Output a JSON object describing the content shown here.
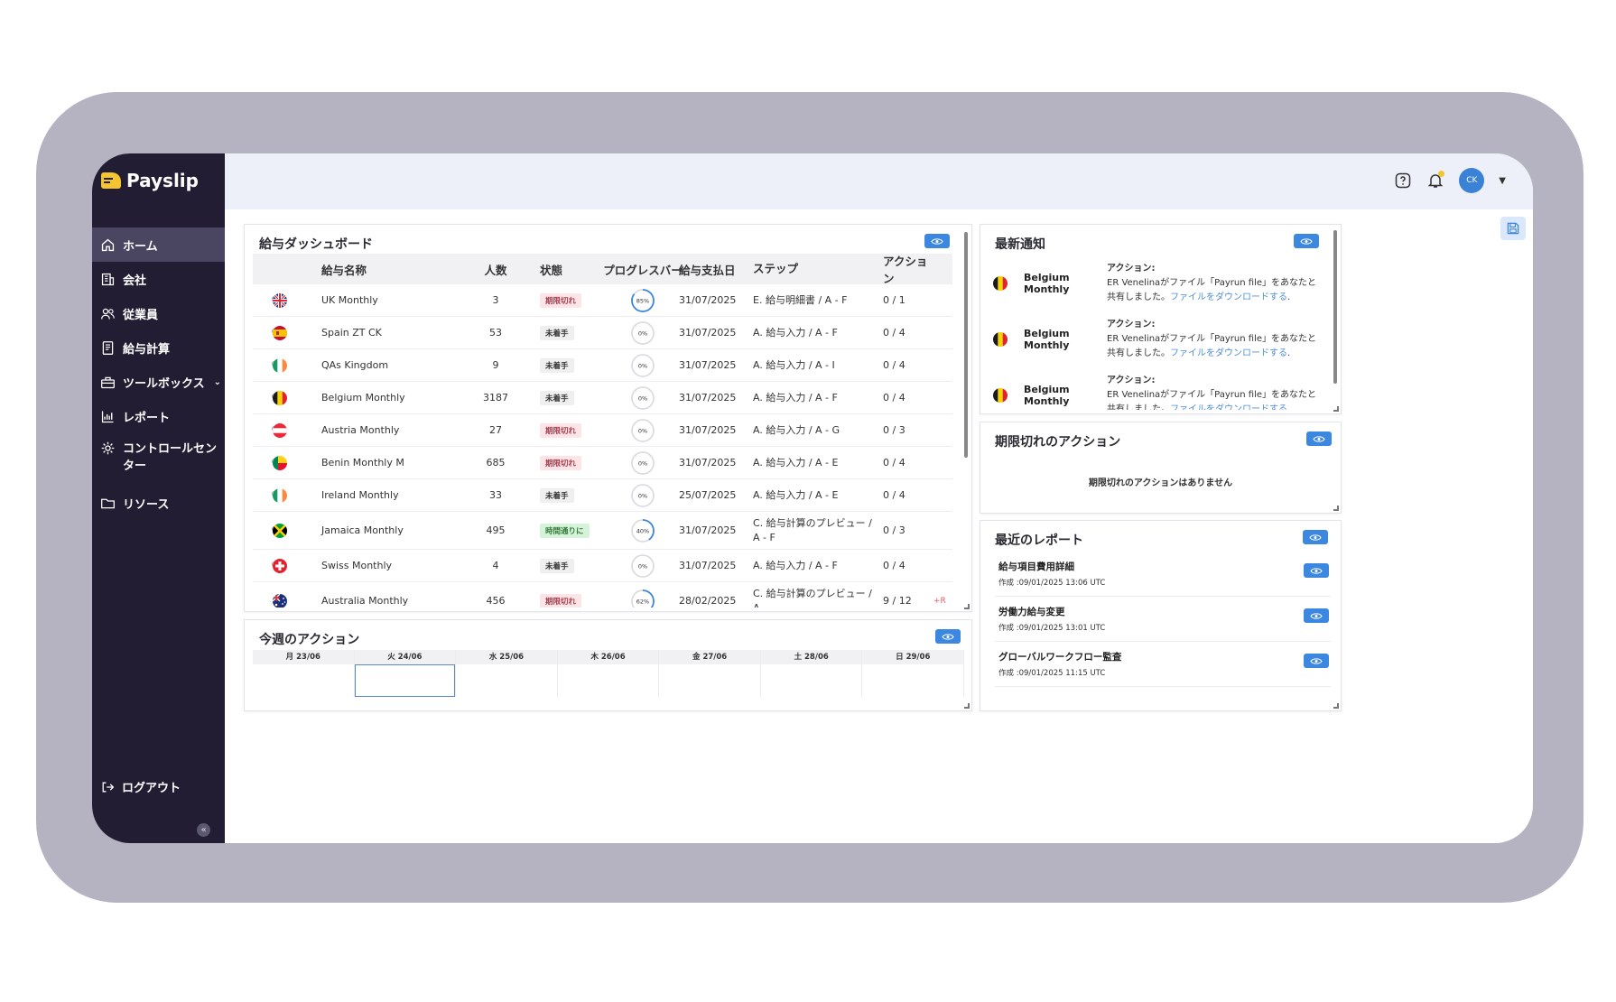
{
  "brand": {
    "name": "Payslip",
    "logo_color": "#f4c531"
  },
  "sidebar": {
    "items": [
      {
        "label": "ホーム",
        "icon": "home-icon",
        "active": true
      },
      {
        "label": "会社",
        "icon": "building-icon"
      },
      {
        "label": "従業員",
        "icon": "users-icon"
      },
      {
        "label": "給与計算",
        "icon": "payroll-icon"
      },
      {
        "label": "ツールボックス",
        "icon": "toolbox-icon"
      },
      {
        "label": "レポート",
        "icon": "chart-icon"
      },
      {
        "label": "コントロールセンター",
        "icon": "gear-icon"
      },
      {
        "label": "リソース",
        "icon": "folder-icon"
      }
    ],
    "logout": "ログアウト",
    "collapse": "«"
  },
  "header": {
    "avatar": "CK",
    "help_icon": "help-icon",
    "bell_icon": "bell-icon"
  },
  "dashboard": {
    "title": "給与ダッシュボード",
    "columns": [
      "給与名称",
      "人数",
      "状態",
      "プログレスバー",
      "給与支払日",
      "ステップ",
      "アクション"
    ],
    "rows": [
      {
        "flag": "uk",
        "name": "UK Monthly",
        "count": "3",
        "status": "期限切れ",
        "status_type": "overdue",
        "progress": 85,
        "progress_label": "85%",
        "date": "31/07/2025",
        "step": "E. 給与明細書 / A - F",
        "action": "0 / 1"
      },
      {
        "flag": "es",
        "name": "Spain ZT CK",
        "count": "53",
        "status": "未着手",
        "status_type": "notstarted",
        "progress": 0,
        "progress_label": "0%",
        "date": "31/07/2025",
        "step": "A. 給与入力 / A - F",
        "action": "0 / 4"
      },
      {
        "flag": "ie",
        "name": "QAs Kingdom",
        "count": "9",
        "status": "未着手",
        "status_type": "notstarted",
        "progress": 0,
        "progress_label": "0%",
        "date": "31/07/2025",
        "step": "A. 給与入力 / A - I",
        "action": "0 / 4"
      },
      {
        "flag": "be",
        "name": "Belgium Monthly",
        "count": "3187",
        "status": "未着手",
        "status_type": "notstarted",
        "progress": 0,
        "progress_label": "0%",
        "date": "31/07/2025",
        "step": "A. 給与入力 / A - F",
        "action": "0 / 4"
      },
      {
        "flag": "at",
        "name": "Austria Monthly",
        "count": "27",
        "status": "期限切れ",
        "status_type": "overdue",
        "progress": 0,
        "progress_label": "0%",
        "date": "31/07/2025",
        "step": "A. 給与入力 / A - G",
        "action": "0 / 3"
      },
      {
        "flag": "bj",
        "name": "Benin Monthly M",
        "count": "685",
        "status": "期限切れ",
        "status_type": "overdue",
        "progress": 0,
        "progress_label": "0%",
        "date": "31/07/2025",
        "step": "A. 給与入力 / A - E",
        "action": "0 / 4"
      },
      {
        "flag": "ie",
        "name": "Ireland Monthly",
        "count": "33",
        "status": "未着手",
        "status_type": "notstarted",
        "progress": 0,
        "progress_label": "0%",
        "date": "25/07/2025",
        "step": "A. 給与入力 / A - E",
        "action": "0 / 4"
      },
      {
        "flag": "jm",
        "name": "Jamaica Monthly",
        "count": "495",
        "status": "時間通りに",
        "status_type": "ontime",
        "progress": 40,
        "progress_label": "40%",
        "date": "31/07/2025",
        "step": "C. 給与計算のプレビュー / A - F",
        "action": "0 / 3",
        "tall": true
      },
      {
        "flag": "ch",
        "name": "Swiss Monthly",
        "count": "4",
        "status": "未着手",
        "status_type": "notstarted",
        "progress": 0,
        "progress_label": "0%",
        "date": "31/07/2025",
        "step": "A. 給与入力 / A - F",
        "action": "0 / 4"
      },
      {
        "flag": "au",
        "name": "Australia Monthly",
        "count": "456",
        "status": "期限切れ",
        "status_type": "overdue",
        "progress": 62,
        "progress_label": "62%",
        "date": "28/02/2025",
        "step": "C. 給与計算のプレビュー / A -",
        "action": "9 / 12",
        "extra": "+R",
        "tall": true
      }
    ]
  },
  "week": {
    "title": "今週のアクション",
    "days": [
      "月 23/06",
      "火 24/06",
      "水 25/06",
      "木 26/06",
      "金 27/06",
      "土 28/06",
      "日 29/06"
    ],
    "selected": 1
  },
  "notifications": {
    "title": "最新通知",
    "items": [
      {
        "flag": "be",
        "name": "Belgium Monthly",
        "label": "アクション:",
        "text": "ER Venelinaがファイル「Payrun file」をあなたと共有しました。",
        "link": "ファイルをダウンロードする",
        "tail": "."
      },
      {
        "flag": "be",
        "name": "Belgium Monthly",
        "label": "アクション:",
        "text": "ER Venelinaがファイル「Payrun file」をあなたと共有しました。",
        "link": "ファイルをダウンロードする",
        "tail": "."
      },
      {
        "flag": "be",
        "name": "Belgium Monthly",
        "label": "アクション:",
        "text": "ER Venelinaがファイル「Payrun file」をあなたと共有しました。",
        "link": "ファイルをダウンロードする",
        "tail": "."
      }
    ]
  },
  "overdue": {
    "title": "期限切れのアクション",
    "empty": "期限切れのアクションはありません"
  },
  "reports": {
    "title": "最近のレポート",
    "items": [
      {
        "name": "給与項目費用詳細",
        "date": "作成 :09/01/2025 13:06 UTC"
      },
      {
        "name": "労働力給与変更",
        "date": "作成 :09/01/2025 13:01 UTC"
      },
      {
        "name": "グローバルワークフロー監査",
        "date": "作成 :09/01/2025 11:15 UTC"
      }
    ]
  },
  "colors": {
    "accent": "#3c87e0",
    "sidebar": "#221d33",
    "frame": "#b5b3c2"
  }
}
